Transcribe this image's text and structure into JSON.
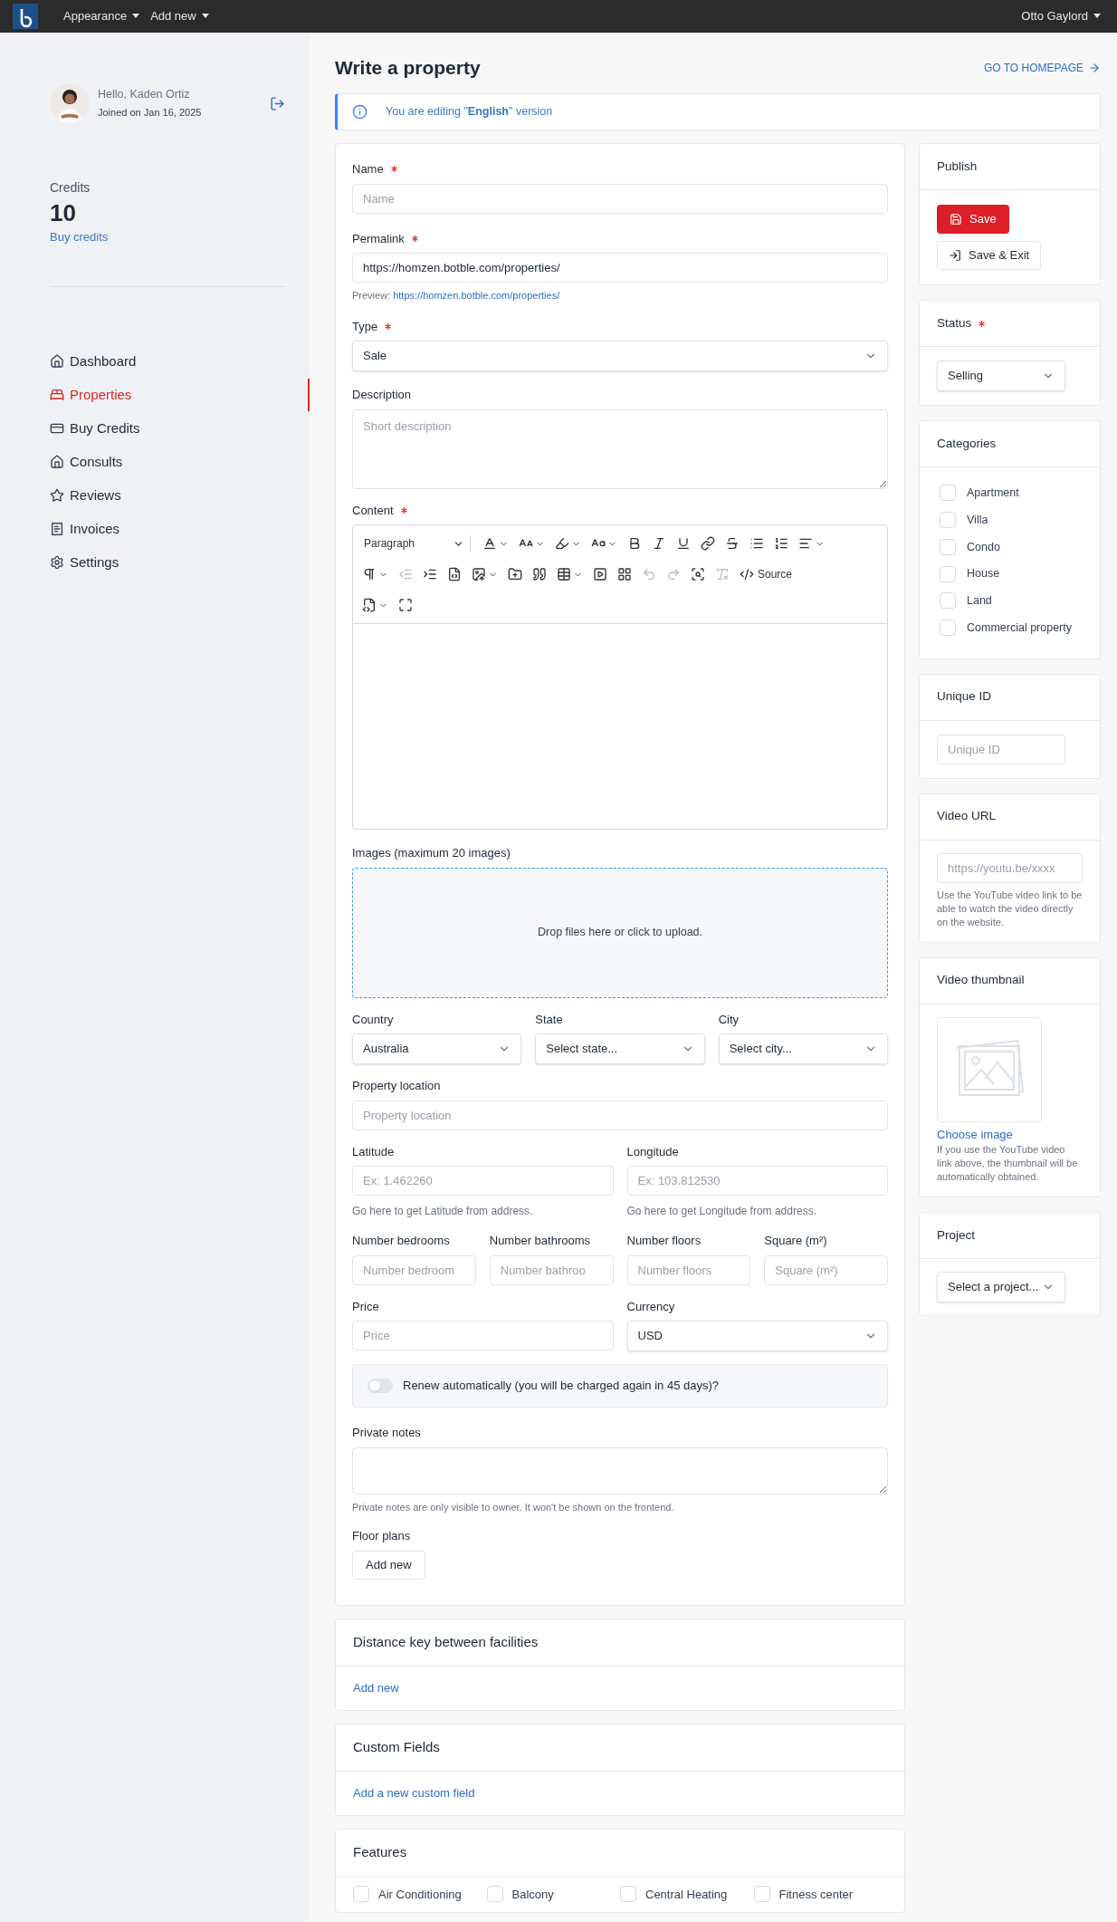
{
  "top_bar": {
    "menus": [
      {
        "label": "Appearance"
      },
      {
        "label": "Add new"
      }
    ],
    "user": "Otto Gaylord"
  },
  "sidebar": {
    "greeting": "Hello, Kaden Ortiz",
    "joined": "Joined on Jan 16, 2025",
    "credits_label": "Credits",
    "credits": "10",
    "buy_credits": "Buy credits",
    "nav": [
      {
        "label": "Dashboard",
        "selected": false
      },
      {
        "label": "Properties",
        "selected": true
      },
      {
        "label": "Buy Credits",
        "selected": false
      },
      {
        "label": "Consults",
        "selected": false
      },
      {
        "label": "Reviews",
        "selected": false
      },
      {
        "label": "Invoices",
        "selected": false
      },
      {
        "label": "Settings",
        "selected": false
      }
    ]
  },
  "page": {
    "title": "Write a property",
    "homepage_link": "GO TO HOMEPAGE",
    "notice": "You are editing \"**English**\" version"
  },
  "form": {
    "name": {
      "label": "Name",
      "required": true,
      "placeholder": "Name"
    },
    "permalink": {
      "label": "Permalink",
      "required": true,
      "value": "https://homzen.botble.com/properties/",
      "preview_label": "Preview:",
      "preview_link": "https://homzen.botble.com/properties/"
    },
    "type": {
      "label": "Type",
      "required": true,
      "value": "Sale"
    },
    "description": {
      "label": "Description",
      "required": false,
      "placeholder": "Short description"
    },
    "content": {
      "label": "Content",
      "required": true,
      "format": "Paragraph",
      "tools": [
        {
          "disabled": false
        },
        {
          "disabled": false
        },
        {
          "disabled": false
        },
        {
          "disabled": false
        },
        {
          "disabled": false
        },
        {
          "disabled": false
        },
        {
          "disabled": false
        },
        {
          "disabled": false
        },
        {
          "disabled": false
        },
        {
          "disabled": false
        },
        {
          "disabled": false
        },
        {
          "disabled": false
        },
        {
          "disabled": false
        },
        {
          "disabled": true
        },
        {
          "disabled": false
        },
        {
          "disabled": false
        },
        {
          "disabled": false
        },
        {
          "disabled": false
        },
        {
          "disabled": false
        },
        {
          "disabled": false
        },
        {
          "disabled": false
        },
        {
          "disabled": false
        },
        {
          "disabled": true
        },
        {
          "disabled": true
        },
        {
          "disabled": false
        },
        {
          "disabled": true
        },
        {
          "disabled": false,
          "label": "Source"
        },
        {
          "disabled": false
        },
        {
          "disabled": false
        }
      ]
    },
    "images": {
      "label": "Images (maximum 20 images)",
      "drop_text": "Drop files here or click to upload."
    },
    "location_selects": [
      {
        "label": "Country",
        "value": "Australia"
      },
      {
        "label": "State",
        "value": "Select state..."
      },
      {
        "label": "City",
        "value": "Select city..."
      }
    ],
    "property_location": {
      "label": "Property location",
      "placeholder": "Property location"
    },
    "coordinates": [
      {
        "label": "Latitude",
        "placeholder": "Ex: 1.462260",
        "hint": "Go here to get Latitude from address."
      },
      {
        "label": "Longitude",
        "placeholder": "Ex: 103.812530",
        "hint": "Go here to get Longitude from address."
      }
    ],
    "numbers": [
      {
        "label": "Number bedrooms",
        "placeholder": "Number bedroom"
      },
      {
        "label": "Number bathrooms",
        "placeholder": "Number bathroo"
      },
      {
        "label": "Number floors",
        "placeholder": "Number floors"
      },
      {
        "label": "Square (m²)",
        "placeholder": "Square (m²)"
      }
    ],
    "price": {
      "label": "Price",
      "placeholder": "Price"
    },
    "currency": {
      "label": "Currency",
      "value": "USD"
    },
    "renew": {
      "label": "Renew automatically (you will be charged again in 45 days)?",
      "on": false
    },
    "private_notes": {
      "label": "Private notes",
      "hint": "Private notes are only visible to owner. It won't be shown on the frontend."
    },
    "floor_plans": {
      "label": "Floor plans",
      "button": "Add new"
    }
  },
  "sections": [
    {
      "title": "Distance key between facilities",
      "link": "Add new"
    },
    {
      "title": "Custom Fields",
      "link": "Add a new custom field"
    }
  ],
  "features": {
    "title": "Features",
    "items": [
      {
        "label": "Air Conditioning",
        "checked": false
      },
      {
        "label": "Balcony",
        "checked": false
      },
      {
        "label": "Central Heating",
        "checked": false
      },
      {
        "label": "Fitness center",
        "checked": false
      }
    ]
  },
  "side_panels": {
    "publish": {
      "title": "Publish",
      "save": "Save",
      "save_exit": "Save & Exit"
    },
    "status": {
      "title": "Status",
      "required": true,
      "value": "Selling"
    },
    "categories": {
      "title": "Categories",
      "items": [
        {
          "label": "Apartment",
          "checked": false
        },
        {
          "label": "Villa",
          "checked": false
        },
        {
          "label": "Condo",
          "checked": false
        },
        {
          "label": "House",
          "checked": false
        },
        {
          "label": "Land",
          "checked": false
        },
        {
          "label": "Commercial property",
          "checked": false
        }
      ]
    },
    "unique_id": {
      "title": "Unique ID",
      "placeholder": "Unique ID"
    },
    "video_url": {
      "title": "Video URL",
      "placeholder": "https://youtu.be/xxxx",
      "hint": "Use the YouTube video link to be able to watch the video directly on the website."
    },
    "video_thumbnail": {
      "title": "Video thumbnail",
      "choose": "Choose image",
      "hint": "If you use the YouTube video link above, the thumbnail will be automatically obtained."
    },
    "project": {
      "title": "Project",
      "value": "Select a project..."
    }
  }
}
